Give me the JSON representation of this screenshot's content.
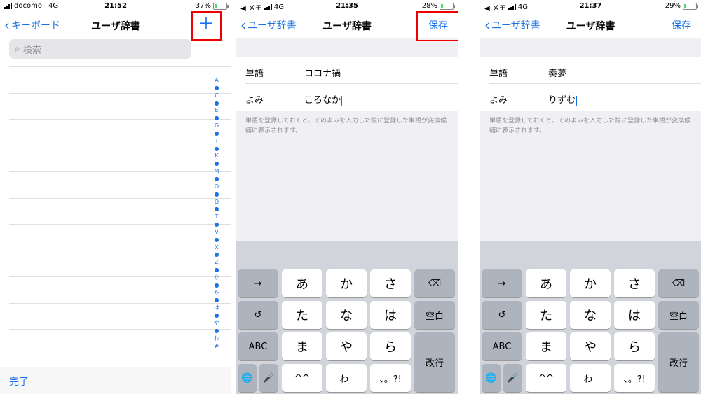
{
  "screen1": {
    "status": {
      "carrier": "docomo",
      "network": "4G",
      "time": "21:52",
      "battery": "37%",
      "battery_level": 0.37
    },
    "nav": {
      "back": "キーボード",
      "title": "ユーザ辞書",
      "add_icon": "plus-icon"
    },
    "search": {
      "placeholder": "検索",
      "icon": "magnifier-icon"
    },
    "index": [
      "A",
      "●",
      "C",
      "●",
      "E",
      "●",
      "G",
      "●",
      "I",
      "●",
      "K",
      "●",
      "M",
      "●",
      "O",
      "●",
      "Q",
      "●",
      "T",
      "●",
      "V",
      "●",
      "X",
      "●",
      "Z",
      "●",
      "か",
      "●",
      "た",
      "●",
      "は",
      "●",
      "や",
      "●",
      "わ",
      "#"
    ],
    "done": "完了"
  },
  "screen2": {
    "status": {
      "back_app": "◀ メモ",
      "network": "4G",
      "time": "21:35",
      "battery": "28%",
      "battery_level": 0.28
    },
    "nav": {
      "back": "ユーザ辞書",
      "title": "ユーザ辞書",
      "save": "保存"
    },
    "form": {
      "word_label": "単語",
      "word_value": "コロナ禍",
      "reading_label": "よみ",
      "reading_value": "ころなか"
    },
    "note": "単語を登録しておくと、そのよみを入力した際に登録した単語が変換候補に表示されます。"
  },
  "screen3": {
    "status": {
      "back_app": "◀ メモ",
      "network": "4G",
      "time": "21:37",
      "battery": "29%",
      "battery_level": 0.29
    },
    "nav": {
      "back": "ユーザ辞書",
      "title": "ユーザ辞書",
      "save": "保存"
    },
    "form": {
      "word_label": "単語",
      "word_value": "奏夢",
      "reading_label": "よみ",
      "reading_value": "りずむ"
    },
    "note": "単語を登録しておくと、そのよみを入力した際に登録した単語が変換候補に表示されます。"
  },
  "keyboard": {
    "arrow": "→",
    "undo": "↺",
    "abc": "ABC",
    "globe": "🌐",
    "mic": "🎤",
    "delete": "⌫",
    "space": "空白",
    "enter": "改行",
    "row1": [
      "あ",
      "か",
      "さ"
    ],
    "row2": [
      "た",
      "な",
      "は"
    ],
    "row3": [
      "ま",
      "や",
      "ら"
    ],
    "row4": [
      "^^",
      "わ_",
      "、。?!"
    ]
  },
  "colors": {
    "accent": "#1a73e8",
    "highlight": "#e00000"
  }
}
